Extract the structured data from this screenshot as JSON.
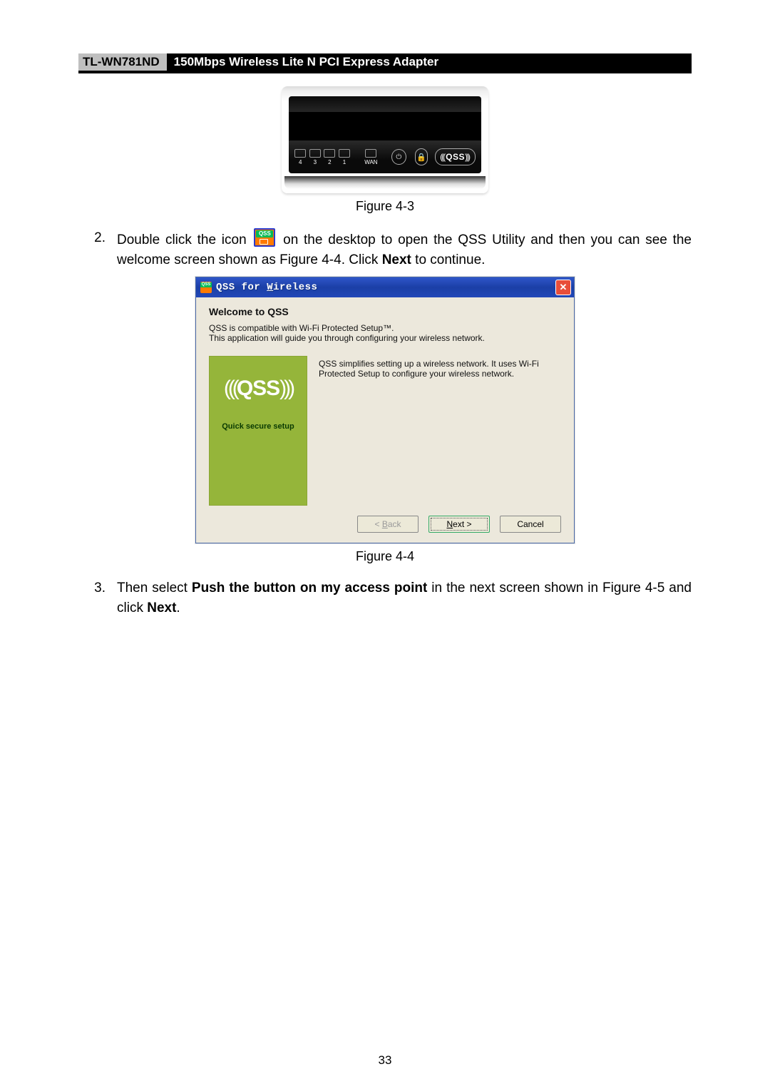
{
  "header": {
    "model": "TL-WN781ND",
    "product": "150Mbps Wireless Lite N PCI Express Adapter"
  },
  "figure43": {
    "caption": "Figure 4-3",
    "ports": [
      "4",
      "3",
      "2",
      "1"
    ],
    "wan": "WAN",
    "qss": "QSS"
  },
  "step2": {
    "num": "2.",
    "t1": "Double click the icon ",
    "t2": " on the desktop to open the QSS Utility and then you can see the welcome screen shown as Figure 4-4. Click ",
    "bold": "Next",
    "t3": " to continue."
  },
  "dialog": {
    "title": "QSS for Wireless",
    "heading": "Welcome to QSS",
    "line1": "QSS is compatible with Wi-Fi Protected Setup™.",
    "line2": "This application will guide you through configuring your wireless network.",
    "panel_sub": "Quick secure setup",
    "panel_logo": "QSS",
    "desc": "QSS simplifies setting up a wireless network. It uses Wi-Fi Protected Setup to configure your wireless network.",
    "back": "< Back",
    "next": "Next >",
    "cancel": "Cancel"
  },
  "figure44": {
    "caption": "Figure 4-4"
  },
  "step3": {
    "num": "3.",
    "t1": "Then select ",
    "bold1": "Push the button on my access point",
    "t2": " in the next screen shown in Figure 4-5 and click ",
    "bold2": "Next",
    "t3": "."
  },
  "page_number": "33"
}
